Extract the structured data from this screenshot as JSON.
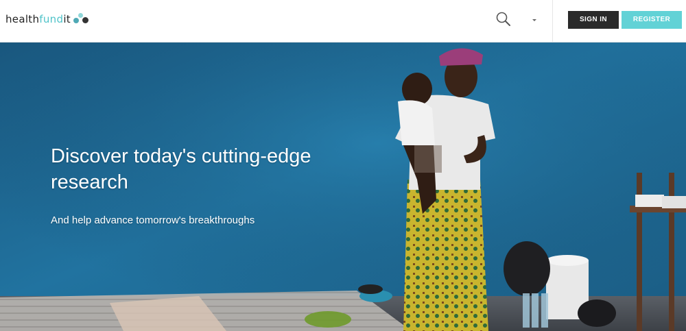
{
  "header": {
    "logo": {
      "part1": "health",
      "part2": "fund",
      "part3": "it"
    },
    "icons": {
      "search": "search-icon",
      "dropdown": "caret-down-icon"
    },
    "sign_in_label": "SIGN IN",
    "register_label": "REGISTER"
  },
  "hero": {
    "title": "Discover today's cutting-edge research",
    "subtitle": "And help advance tomorrow's breakthroughs"
  },
  "colors": {
    "brand_teal": "#62d2d6",
    "sign_in_bg": "#2a2a2a",
    "hero_wall": "#1e5f86"
  }
}
